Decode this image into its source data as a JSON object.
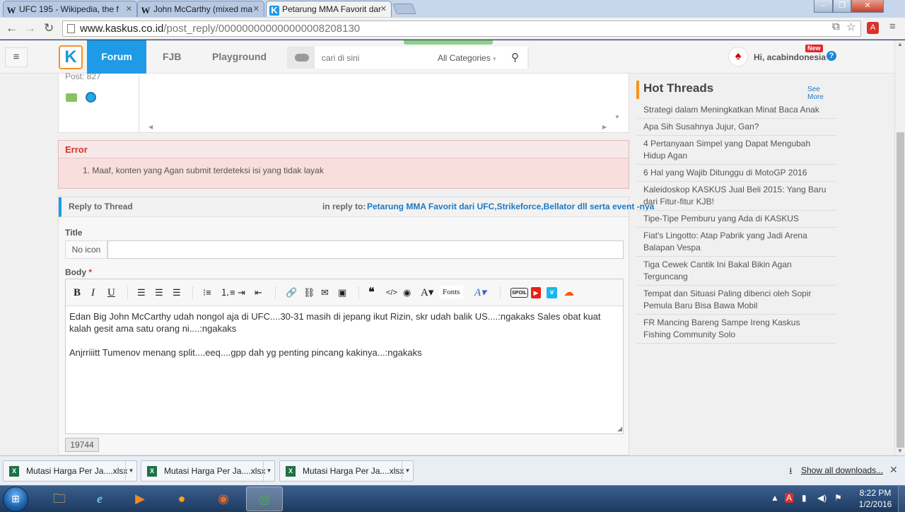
{
  "browser": {
    "tabs": [
      {
        "favicon": "W",
        "title": "UFC 195 - Wikipedia, the f"
      },
      {
        "favicon": "W",
        "title": "John McCarthy (mixed ma"
      },
      {
        "favicon": "K",
        "title": "Petarung MMA Favorit dar"
      }
    ],
    "tab_close": "✕",
    "url_host": "www.kaskus.co.id",
    "url_path": "/post_reply/000000000000000008208130",
    "window_buttons": {
      "minimize": "‒",
      "maximize": "❐",
      "close": "✕"
    }
  },
  "kaskus": {
    "logo_letter": "K",
    "nav": {
      "forum": "Forum",
      "fjb": "FJB",
      "playground": "Playground"
    },
    "search": {
      "placeholder": "cari di sini",
      "category": "All Categories",
      "caret": "▾"
    },
    "user": {
      "greeting": "Hi, acabindonesia",
      "badge": "New",
      "help": "?"
    }
  },
  "post": {
    "post_count": "Post: 827"
  },
  "error": {
    "title": "Error",
    "message": "1.  Maaf, konten yang Agan submit terdeteksi isi yang tidak layak"
  },
  "reply": {
    "header": "Reply to Thread",
    "in_reply_label": "in reply to:",
    "thread_title": "Petarung MMA Favorit dari UFC,Strikeforce,Bellator dll serta event -nya",
    "title_label": "Title",
    "no_icon": "No icon",
    "body_label": "Body",
    "required_mark": "*",
    "toolbar": {
      "bold": "B",
      "italic": "I",
      "underline": "U",
      "fonts": "Fonts",
      "spoiler": "SPOIL"
    },
    "body_line1": "Edan Big John McCarthy udah nongol aja di UFC....30-31 masih di jepang ikut Rizin, skr udah balik US....:ngakaks Sales obat kuat kalah gesit ama satu orang ni....:ngakaks",
    "body_line2": "Anjrriiitt Tumenov menang split....eeq....gpp dah yg penting pincang kakinya...:ngakaks",
    "char_count": "19744"
  },
  "hot_threads": {
    "title": "Hot Threads",
    "see_more": "See More",
    "items": [
      "Strategi dalam Meningkatkan Minat Baca Anak",
      "Apa Sih Susahnya Jujur, Gan?",
      "4 Pertanyaan Simpel yang Dapat Mengubah Hidup Agan",
      "6 Hal yang Wajib Ditunggu di MotoGP 2016",
      "Kaleidoskop KASKUS Jual Beli 2015: Yang Baru dari Fitur-fitur KJB!",
      "Tipe-Tipe Pemburu yang Ada di KASKUS",
      "Fiat's Lingotto: Atap Pabrik yang Jadi Arena Balapan Vespa",
      "Tiga Cewek Cantik Ini Bakal Bikin Agan Terguncang",
      "Tempat dan Situasi Paling dibenci oleh Sopir Pemula Baru Bisa Bawa Mobil",
      "FR Mancing Bareng Sampe Ireng Kaskus Fishing Community Solo"
    ]
  },
  "downloads": {
    "items": [
      "Mutasi Harga Per Ja....xlsx",
      "Mutasi Harga Per Ja....xlsx",
      "Mutasi Harga Per Ja....xlsx"
    ],
    "show_all": "Show all downloads...",
    "close": "✕"
  },
  "taskbar": {
    "time": "8:22 PM",
    "date": "1/2/2016"
  },
  "colors": {
    "kaskus_blue": "#1e9ae6",
    "hot_orange": "#f7931e",
    "error_red": "#d9312c",
    "error_bg": "#f9dede",
    "link_blue": "#1e78c2"
  }
}
